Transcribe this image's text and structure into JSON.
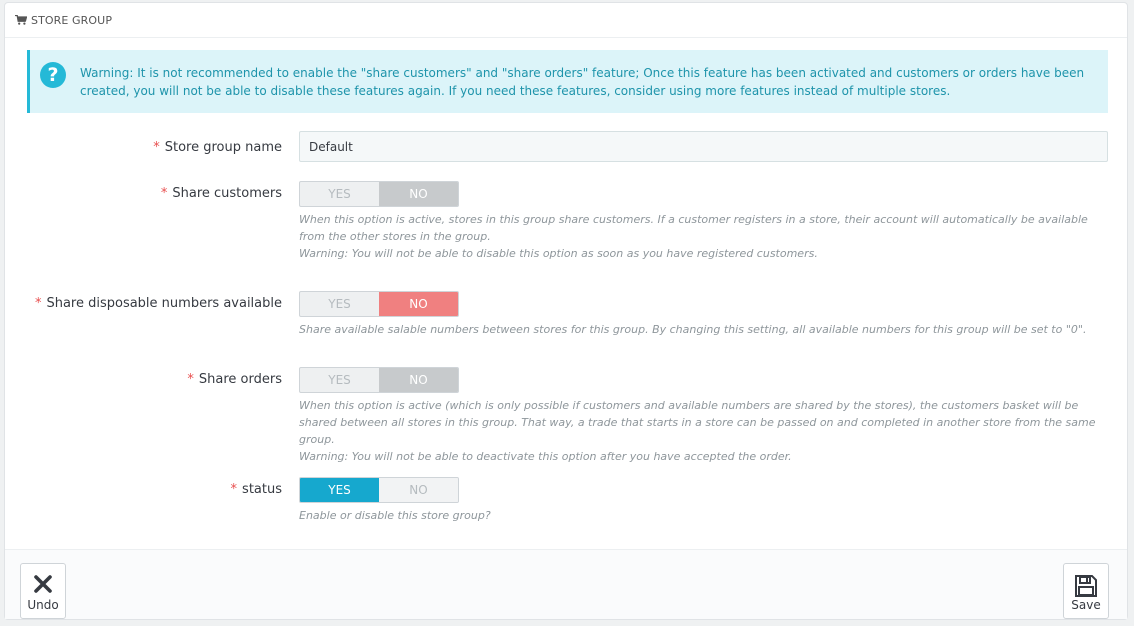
{
  "panel": {
    "title": "STORE GROUP",
    "icon": "shopping-cart-icon"
  },
  "alert": {
    "icon": "question-icon",
    "text": "Warning: It is not recommended to enable the \"share customers\" and \"share orders\" feature; Once this feature has been activated and customers or orders have been created, you will not be able to disable these features again. If you need these features, consider using more features instead of multiple stores."
  },
  "form": {
    "required_mark": "*",
    "name": {
      "label": "Store group name",
      "value": "Default"
    },
    "share_customers": {
      "label": "Share customers",
      "yes": "YES",
      "no": "NO",
      "selected": "NO",
      "help1": "When this option is active, stores in this group share customers. If a customer registers in a store, their account will automatically be available from the other stores in the group.",
      "help2": "Warning: You will not be able to disable this option as soon as you have registered customers."
    },
    "share_numbers": {
      "label": "Share disposable numbers available",
      "yes": "YES",
      "no": "NO",
      "selected": "NO",
      "help1": "Share available salable numbers between stores for this group. By changing this setting, all available numbers for this group will be set to \"0\"."
    },
    "share_orders": {
      "label": "Share orders",
      "yes": "YES",
      "no": "NO",
      "selected": "NO",
      "help1": "When this option is active (which is only possible if customers and available numbers are shared by the stores), the customers basket will be shared between all stores in this group. That way, a trade that starts in a store can be passed on and completed in another store from the same group.",
      "help2": "Warning: You will not be able to deactivate this option after you have accepted the order."
    },
    "status": {
      "label": "status",
      "yes": "YES",
      "no": "NO",
      "selected": "YES",
      "help1": "Enable or disable this store group?"
    }
  },
  "footer": {
    "undo_label": "Undo",
    "undo_icon": "close-icon",
    "save_label": "Save",
    "save_icon": "floppy-disk-icon"
  },
  "colors": {
    "accent": "#25b9d7",
    "alert_bg": "#dcf4f9",
    "required": "#e84e4e",
    "no_selected_red": "#f08080",
    "yes_selected_blue": "#16a8ce"
  }
}
